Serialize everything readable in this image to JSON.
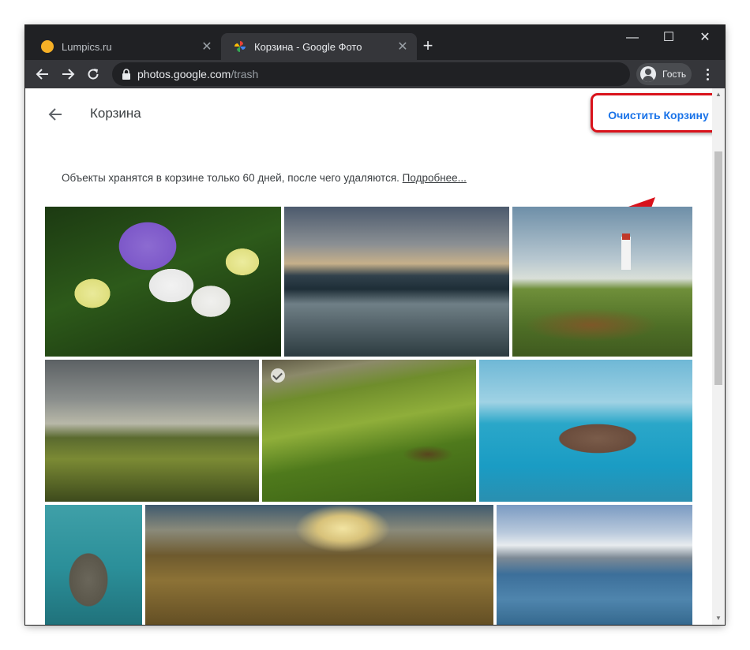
{
  "tabs": [
    {
      "title": "Lumpics.ru",
      "favicon": "lumpics-favicon"
    },
    {
      "title": "Корзина - Google Фото",
      "favicon": "google-photos-icon"
    }
  ],
  "toolbar": {
    "url_host": "photos.google.com",
    "url_path": "/trash",
    "profile_label": "Гость"
  },
  "page": {
    "title": "Корзина",
    "empty_trash_label": "Очистить Корзину",
    "info_text": "Объекты хранятся в корзине только 60 дней, после чего удаляются.",
    "info_link": "Подробнее..."
  },
  "photos": [
    "crocus-flowers",
    "mountain-lake-boat",
    "lighthouse-field",
    "green-valley",
    "green-hills",
    "blue-sea-rocks",
    "baby-hippo",
    "golden-valley",
    "snowy-mountains-lake"
  ],
  "colors": {
    "accent": "#1a73e8",
    "highlight": "#d9121b",
    "tabstrip": "#202124",
    "toolbar": "#35363a"
  }
}
